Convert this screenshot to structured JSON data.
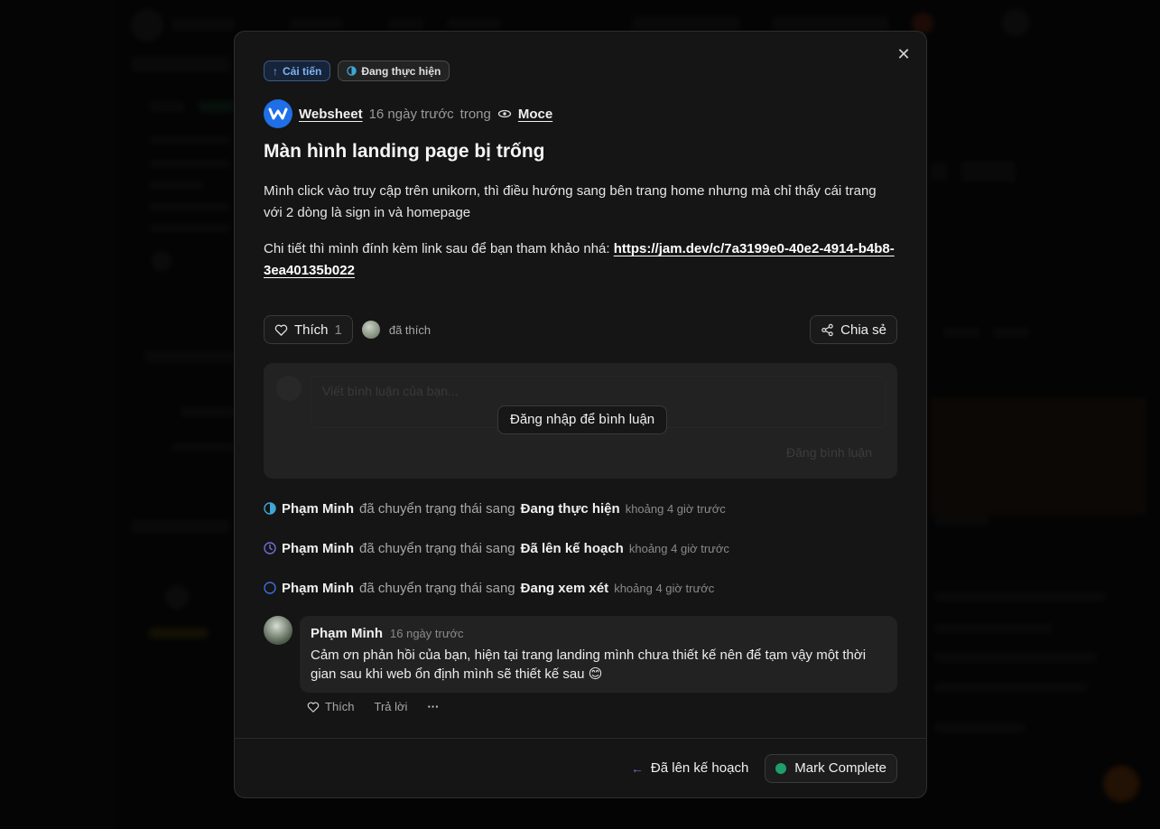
{
  "tags": {
    "type_label": "Cải tiến",
    "status_label": "Đang thực hiện"
  },
  "post": {
    "author": "Websheet",
    "posted_time": "16 ngày trước",
    "in_label": "trong",
    "board": "Moce",
    "title": "Màn hình landing page bị trống",
    "paragraph_1": "Mình click vào truy cập trên unikorn, thì điều hướng sang bên trang home nhưng mà chỉ thấy cái trang với 2 dòng là sign in và homepage",
    "paragraph_2_prefix": "Chi tiết thì mình đính kèm link sau để bạn tham khảo nhá: ",
    "link": "https://jam.dev/c/7a3199e0-40e2-4914-b4b8-3ea40135b022"
  },
  "actions": {
    "like_label": "Thích",
    "like_count": "1",
    "liked_text": "đã thích",
    "share_label": "Chia sẻ"
  },
  "comment_box": {
    "placeholder": "Viết bình luận của bạn...",
    "login_label": "Đăng nhập để bình luận",
    "submit_label": "Đăng bình luận"
  },
  "activity": [
    {
      "name": "Phạm Minh",
      "verb": "đã chuyển trạng thái sang",
      "status": "Đang thực hiện",
      "time": "khoảng 4 giờ trước"
    },
    {
      "name": "Phạm Minh",
      "verb": "đã chuyển trạng thái sang",
      "status": "Đã lên kế hoạch",
      "time": "khoảng 4 giờ trước"
    },
    {
      "name": "Phạm Minh",
      "verb": "đã chuyển trạng thái sang",
      "status": "Đang xem xét",
      "time": "khoảng 4 giờ trước"
    }
  ],
  "reply": {
    "name": "Phạm Minh",
    "time": "16 ngày trước",
    "text": "Cảm ơn phản hồi của bạn, hiện tại trang landing mình chưa thiết kế nên để tạm vậy một thời gian sau khi web ổn định mình sẽ thiết kế sau 😊",
    "like_label": "Thích",
    "reply_label": "Trả lời",
    "more_label": "···"
  },
  "footer": {
    "prev_label": "Đã lên kế hoạch",
    "mark_complete_label": "Mark Complete"
  },
  "colors": {
    "accent_blue": "#1e6fe8",
    "in_progress": "#3fa7d6",
    "planned": "#6f6fd8",
    "review": "#3a6fe0",
    "complete": "#1e9e6a"
  }
}
